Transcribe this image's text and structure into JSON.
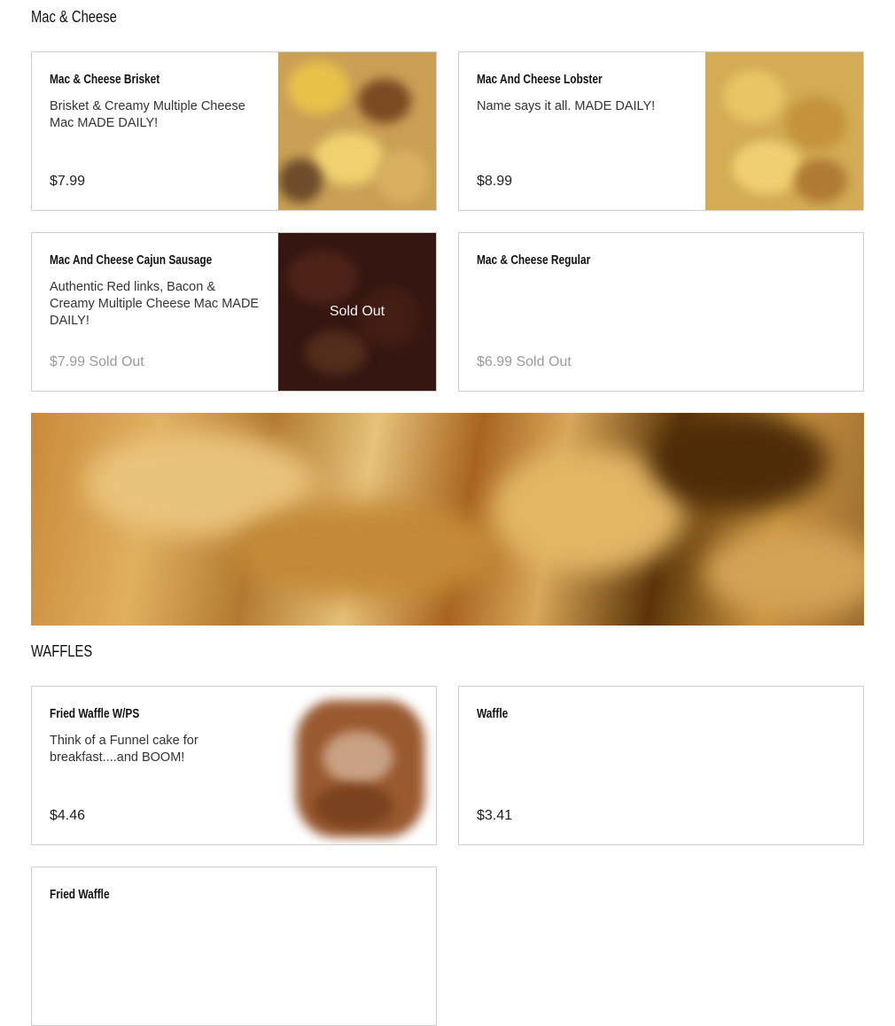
{
  "sections": {
    "mac": {
      "title": "Mac & Cheese"
    },
    "waffles": {
      "title": "WAFFLES"
    }
  },
  "items": {
    "brisket": {
      "name": "Mac & Cheese Brisket",
      "description": "Brisket & Creamy Multiple Cheese Mac MADE DAILY!",
      "price": "$7.99"
    },
    "lobster": {
      "name": "Mac And Cheese Lobster",
      "description": "Name says it all. MADE DAILY!",
      "price": "$8.99"
    },
    "cajun": {
      "name": "Mac And Cheese Cajun Sausage",
      "description": "Authentic Red links, Bacon & Creamy Multiple Cheese Mac MADE DAILY!",
      "price": "$7.99 Sold Out",
      "image_overlay": "Sold Out"
    },
    "regular": {
      "name": "Mac & Cheese Regular",
      "price": "$6.99 Sold Out"
    },
    "fried_waffle_wps": {
      "name": "Fried Waffle W/PS",
      "description": "Think of a Funnel cake for breakfast....and BOOM!",
      "price": "$4.46"
    },
    "waffle": {
      "name": "Waffle",
      "price": "$3.41"
    },
    "fried_waffle": {
      "name": "Fried Waffle"
    }
  },
  "colors": {
    "border": "#cfcfcf",
    "soldout_text": "#9a9a9a",
    "text": "#1a1a1a"
  }
}
